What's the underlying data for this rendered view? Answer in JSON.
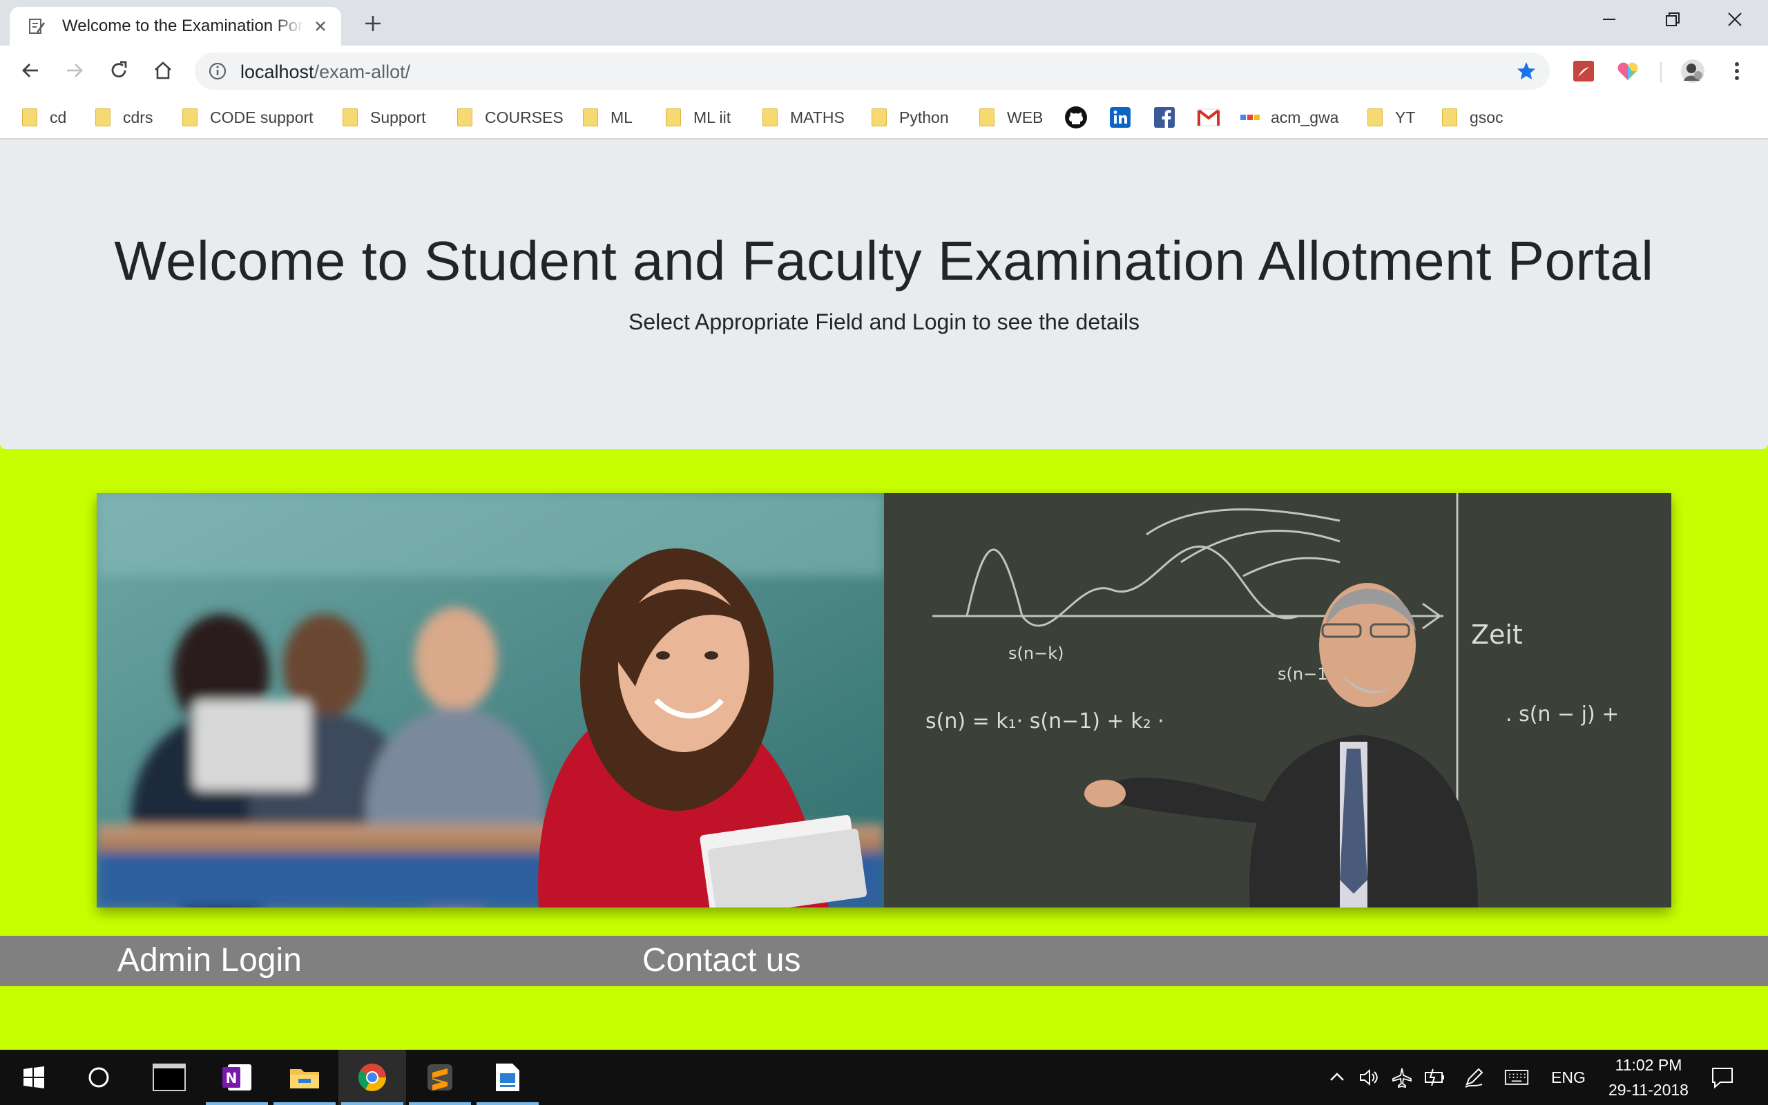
{
  "browser": {
    "tab_title": "Welcome to the Examination Portal",
    "url_host": "localhost",
    "url_path": "/exam-allot/"
  },
  "bookmarks": [
    {
      "label": "cd"
    },
    {
      "label": "cdrs"
    },
    {
      "label": "CODE support"
    },
    {
      "label": "Support"
    },
    {
      "label": "COURSES"
    },
    {
      "label": "ML"
    },
    {
      "label": "ML iit"
    },
    {
      "label": "MATHS"
    },
    {
      "label": "Python"
    },
    {
      "label": "WEB"
    },
    {
      "label": "acm_gwa"
    },
    {
      "label": "YT"
    },
    {
      "label": "gsoc"
    }
  ],
  "page": {
    "title": "Welcome to Student and Faculty Examination Allotment Portal",
    "subtitle": "Select Appropriate Field and Login to see the details",
    "footer_links": {
      "admin_login": "Admin Login",
      "contact_us": "Contact us"
    }
  },
  "taskbar": {
    "language": "ENG",
    "time": "11:02 PM",
    "date": "29-11-2018"
  },
  "colors": {
    "page_background": "#c8ff00",
    "jumbotron": "#e9ecef",
    "footer_bar": "#808080"
  }
}
